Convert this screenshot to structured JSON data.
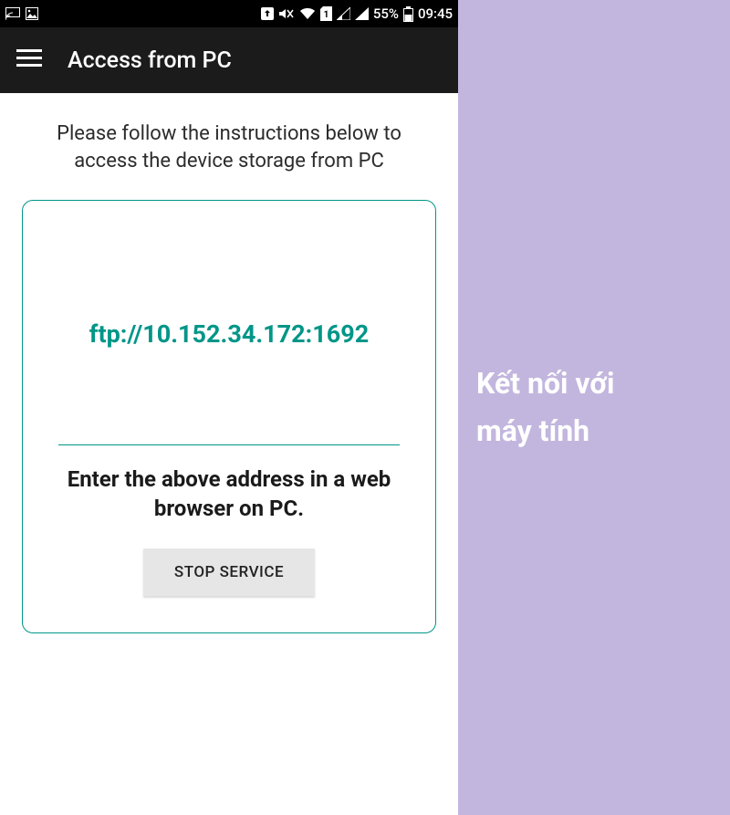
{
  "status": {
    "battery_pct": "55%",
    "clock": "09:45",
    "sim_label": "1"
  },
  "appbar": {
    "title": "Access from PC"
  },
  "main": {
    "instructions": "Please follow the instructions below to access the device storage from PC",
    "ftp_address": "ftp://10.152.34.172:1692",
    "enter_text": "Enter the above address in a web browser on PC.",
    "stop_label": "STOP SERVICE"
  },
  "side": {
    "line1": "Kết nối với",
    "line2": "máy tính"
  }
}
